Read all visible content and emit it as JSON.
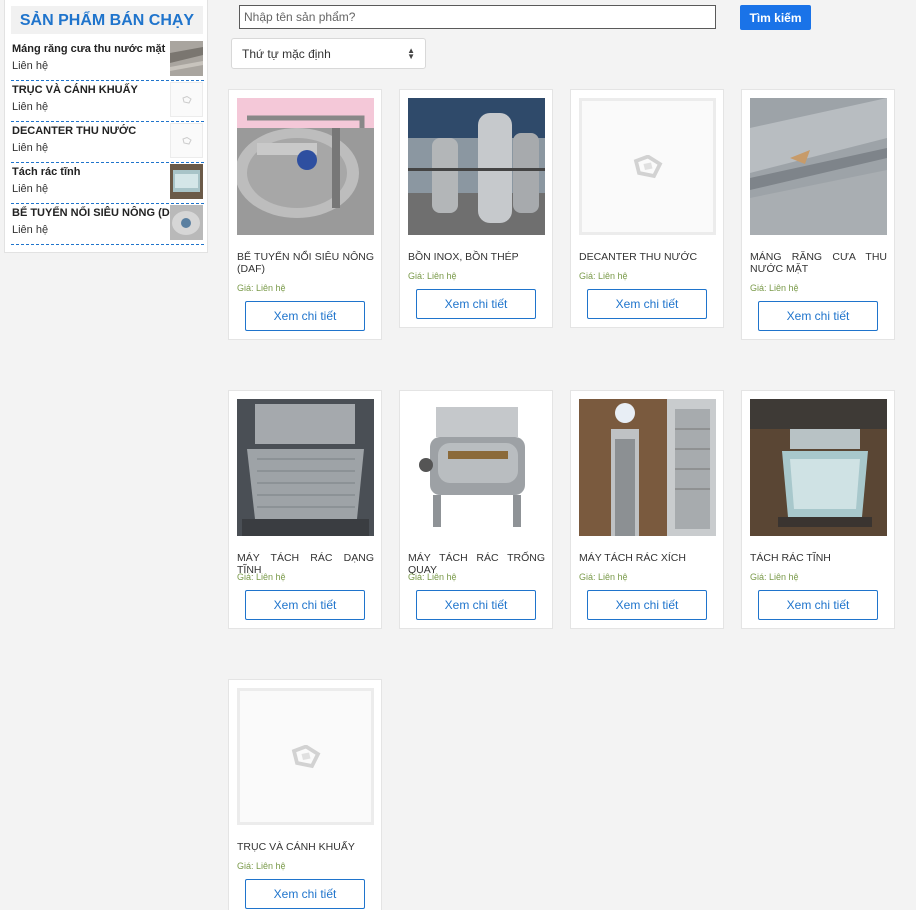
{
  "sidebar": {
    "title": "SẢN PHẨM BÁN CHẠY",
    "items": [
      {
        "name": "Máng răng cưa thu nước mặt",
        "price": "Liên hệ",
        "thumb": "photo"
      },
      {
        "name": "TRỤC VÀ CÁNH KHUẤY",
        "price": "Liên hệ",
        "thumb": "placeholder"
      },
      {
        "name": "DECANTER THU NƯỚC",
        "price": "Liên hệ",
        "thumb": "placeholder"
      },
      {
        "name": "Tách rác tĩnh",
        "price": "Liên hệ",
        "thumb": "photo"
      },
      {
        "name": "BỂ TUYỂN NỔI SIÊU NÔNG (DAF)",
        "price": "Liên hệ",
        "thumb": "photo"
      }
    ]
  },
  "search": {
    "placeholder": "Nhập tên sản phẩm?",
    "button_label": "Tìm kiếm"
  },
  "sort": {
    "selected": "Thứ tự mặc định"
  },
  "products": [
    {
      "name": "BỂ TUYỂN NỔI SIÊU NÔNG (DAF)",
      "price": "Giá: Liên hệ",
      "button": "Xem chi tiết",
      "image": "photo"
    },
    {
      "name": "BỒN INOX, BỒN THÉP",
      "price": "Giá: Liên hệ",
      "button": "Xem chi tiết",
      "image": "photo"
    },
    {
      "name": "DECANTER THU NƯỚC",
      "price": "Giá: Liên hệ",
      "button": "Xem chi tiết",
      "image": "placeholder"
    },
    {
      "name": "MÁNG RĂNG CƯA THU NƯỚC MẶT",
      "price": "Giá: Liên hệ",
      "button": "Xem chi tiết",
      "image": "photo"
    },
    {
      "name": "MÁY TÁCH RÁC DẠNG TĨNH",
      "price": "Giá: Liên hệ",
      "button": "Xem chi tiết",
      "image": "photo"
    },
    {
      "name": "MÁY TÁCH RÁC TRỐNG QUAY",
      "price": "Giá: Liên hệ",
      "button": "Xem chi tiết",
      "image": "photo"
    },
    {
      "name": "MÁY TÁCH RÁC XÍCH",
      "price": "Giá: Liên hệ",
      "button": "Xem chi tiết",
      "image": "photo"
    },
    {
      "name": "TÁCH RÁC TĨNH",
      "price": "Giá: Liên hệ",
      "button": "Xem chi tiết",
      "image": "photo"
    },
    {
      "name": "TRỤC VÀ CÁNH KHUẤY",
      "price": "Giá: Liên hệ",
      "button": "Xem chi tiết",
      "image": "placeholder"
    }
  ]
}
